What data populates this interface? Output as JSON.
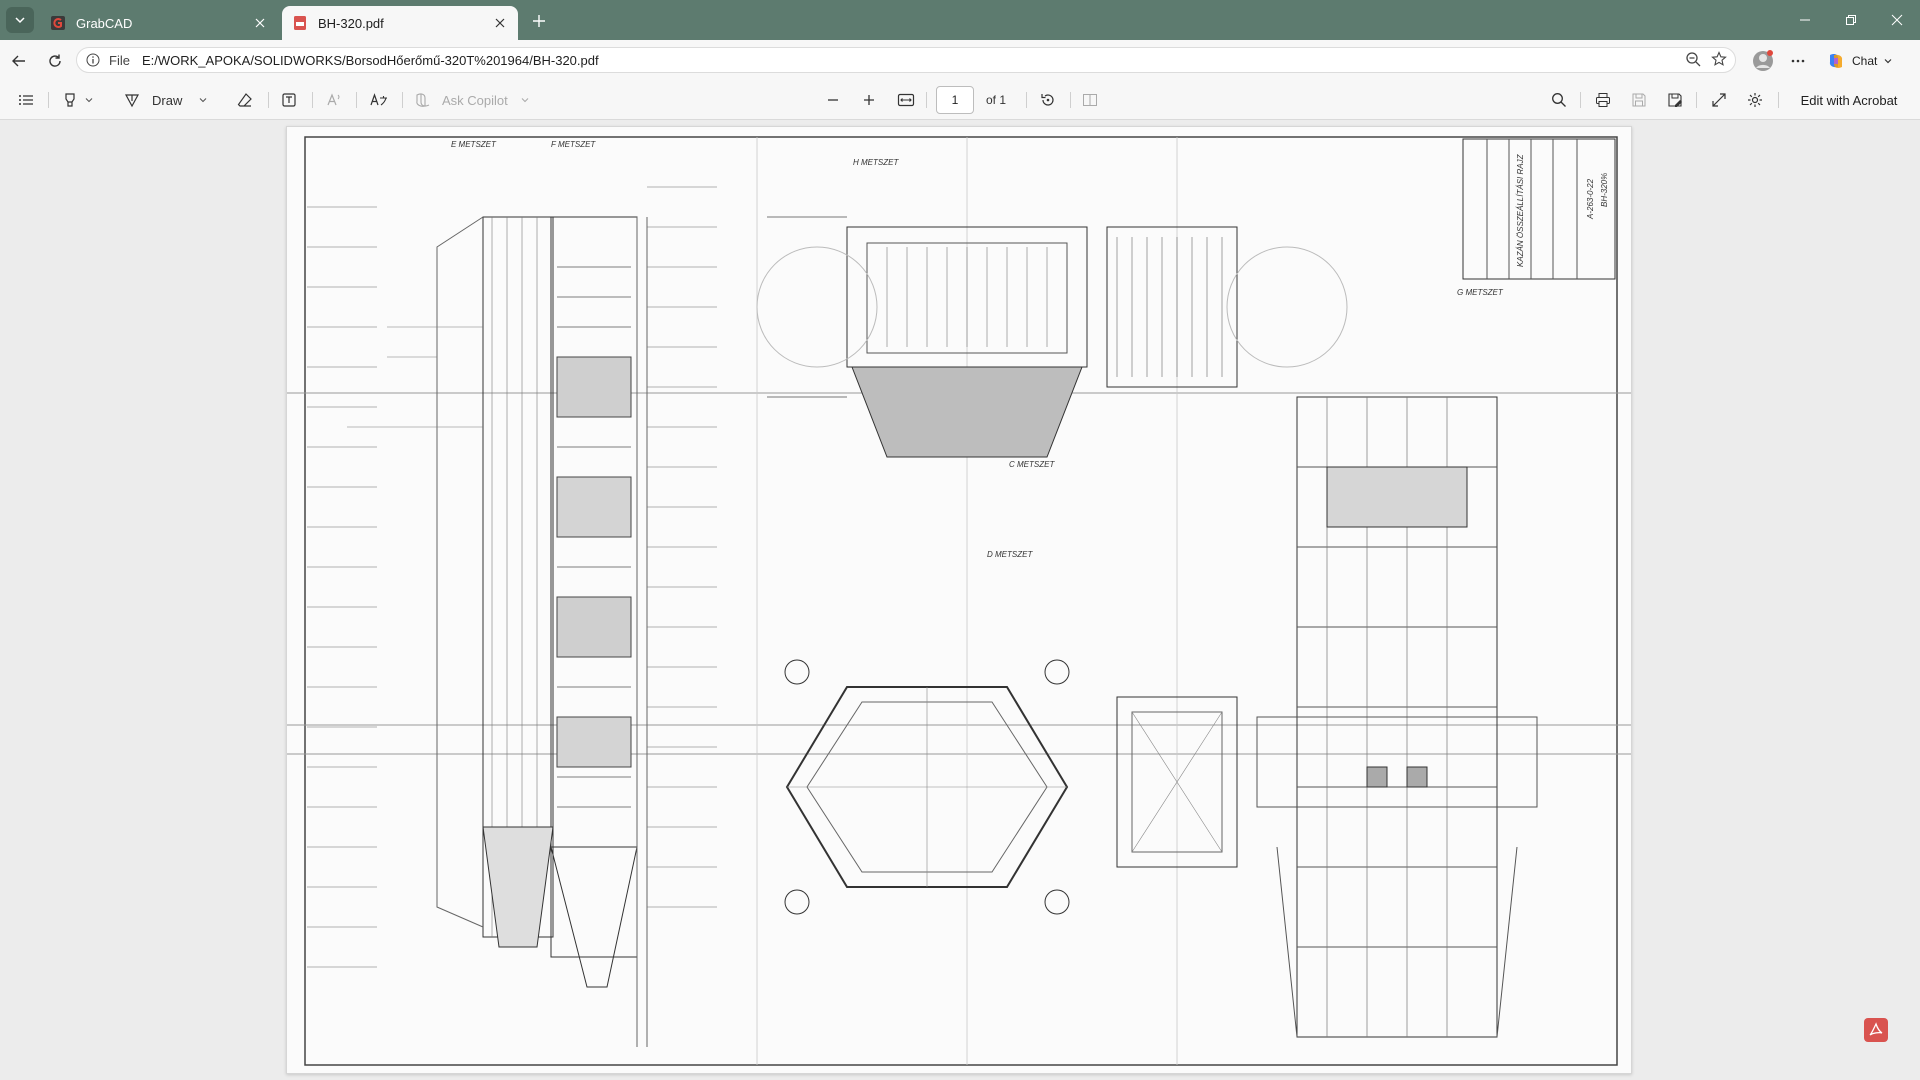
{
  "tabs": [
    {
      "label": "GrabCAD",
      "state": "inactive",
      "icon": "grabcad-icon"
    },
    {
      "label": "BH-320.pdf",
      "state": "active",
      "icon": "pdf-file-icon"
    }
  ],
  "address": {
    "scheme": "File",
    "url": "E:/WORK_APOKA/SOLIDWORKS/BorsodHőerőmű-320T%201964/BH-320.pdf"
  },
  "chat": {
    "label": "Chat"
  },
  "pdf_toolbar": {
    "draw_label": "Draw",
    "ask_copilot_label": "Ask Copilot",
    "page_current": "1",
    "page_total_label": "of 1",
    "edit_acrobat_label": "Edit with Acrobat"
  },
  "drawing": {
    "sections": [
      "E METSZET",
      "F METSZET",
      "H METSZET",
      "G METSZET",
      "C METSZET",
      "D METSZET"
    ],
    "title_block": [
      "BH-320%",
      "A-263-0-22",
      "KAZÁN ÖSSZEÁLLÍTÁSI RAJZ"
    ]
  },
  "colors": {
    "titlebar": "#5d7b6f",
    "toolbar": "#f7f7f7",
    "viewer_bg": "#ececec",
    "acrobat_red": "#d9534f"
  }
}
